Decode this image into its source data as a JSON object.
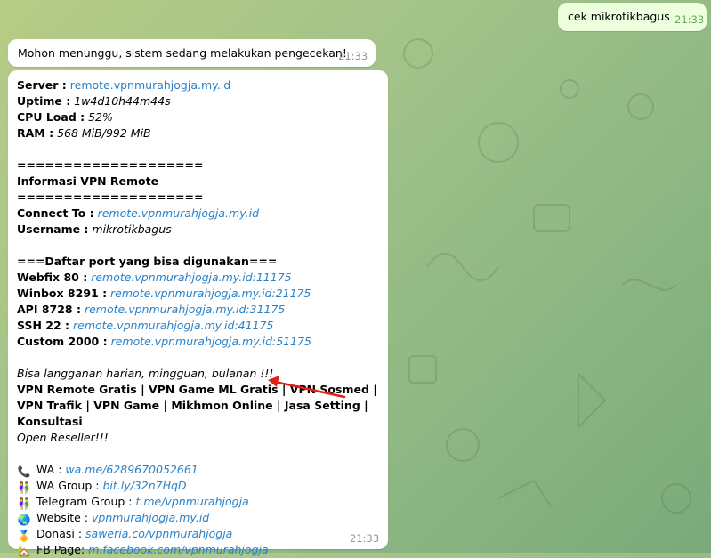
{
  "outgoing": {
    "text": "cek mikrotikbagus",
    "time": "21:33"
  },
  "waiting": {
    "text": "Mohon menunggu, sistem sedang melakukan pengecekan!",
    "time": "21:33"
  },
  "main": {
    "time": "21:33",
    "server_label": "Server :",
    "server_value": "remote.vpnmurahjogja.my.id",
    "uptime_label": "Uptime :",
    "uptime_value": "1w4d10h44m44s",
    "cpu_label": "CPU Load :",
    "cpu_value": "52%",
    "ram_label": "RAM :",
    "ram_value": "568 MiB/992 MiB",
    "separator": "====================",
    "info_title": "Informasi VPN Remote",
    "connect_label": "Connect To :",
    "connect_value": "remote.vpnmurahjogja.my.id",
    "username_label": "Username :",
    "username_value": "mikrotikbagus",
    "ports_title": "===Daftar port yang bisa digunakan===",
    "ports": [
      {
        "label": "Webfix 80 :",
        "value": "remote.vpnmurahjogja.my.id:11175"
      },
      {
        "label": "Winbox 8291 :",
        "value": "remote.vpnmurahjogja.my.id:21175"
      },
      {
        "label": "API 8728 :",
        "value": "remote.vpnmurahjogja.my.id:31175"
      },
      {
        "label": "SSH 22 :",
        "value": "remote.vpnmurahjogja.my.id:41175"
      },
      {
        "label": "Custom 2000 :",
        "value": "remote.vpnmurahjogja.my.id:51175"
      }
    ],
    "promo_italic": "Bisa langganan harian, mingguan, bulanan !!!",
    "promo_services": "VPN Remote Gratis | VPN Game ML Gratis | VPN Sosmed | VPN Trafik | VPN Game | Mikhmon Online | Jasa Setting | Konsultasi",
    "reseller": "Open Reseller!!!",
    "contacts": [
      {
        "icon": "phone-icon",
        "glyph": "📞",
        "label": "WA :",
        "value": "wa.me/6289670052661"
      },
      {
        "icon": "people-icon",
        "glyph": "👫",
        "label": "WA Group :",
        "value": "bit.ly/32n7HqD"
      },
      {
        "icon": "people-icon",
        "glyph": "👫",
        "label": "Telegram Group :",
        "value": "t.me/vpnmurahjogja"
      },
      {
        "icon": "globe-icon",
        "glyph": "🌏",
        "label": "Website :",
        "value": "vpnmurahjogja.my.id"
      },
      {
        "icon": "medal-icon",
        "glyph": "🏅",
        "label": "Donasi :",
        "value": "saweria.co/vpnmurahjogja"
      },
      {
        "icon": "house-icon",
        "glyph": "🏡",
        "label": "FB Page:",
        "value": "m.facebook.com/vpnmurahjogja"
      }
    ]
  },
  "colors": {
    "link": "#2a82c9",
    "arrow": "#e0221b",
    "outgoing_bg": "#eeffde"
  }
}
